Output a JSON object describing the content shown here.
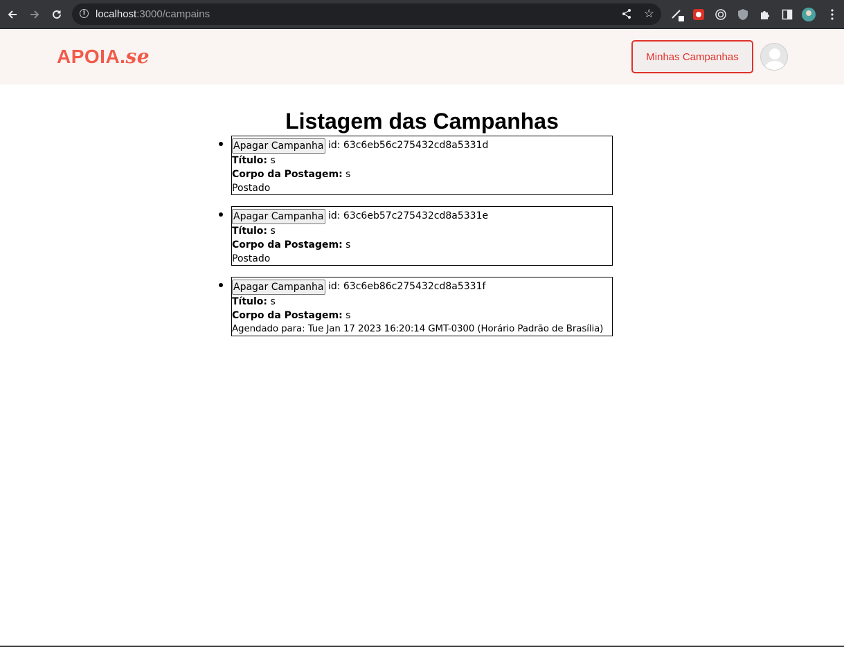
{
  "browser": {
    "url_host": "localhost",
    "url_path": ":3000/campains"
  },
  "header": {
    "logo_main": "APOIA.",
    "logo_suffix": "se",
    "my_campaigns_label": "Minhas Campanhas"
  },
  "main": {
    "title": "Listagem das Campanhas",
    "delete_label": "Apagar Campanha",
    "id_prefix": "id: ",
    "title_label": "Título:",
    "body_label": "Corpo da Postagem:",
    "campaigns": [
      {
        "id": "63c6eb56c275432cd8a5331d",
        "title": "s",
        "body": "s",
        "status": "Postado"
      },
      {
        "id": "63c6eb57c275432cd8a5331e",
        "title": "s",
        "body": "s",
        "status": "Postado"
      },
      {
        "id": "63c6eb86c275432cd8a5331f",
        "title": "s",
        "body": "s",
        "status": "Agendado para: Tue Jan 17 2023 16:20:14 GMT-0300 (Horário Padrão de Brasília)"
      }
    ]
  },
  "colors": {
    "brand": "#f15a4a",
    "button_border": "#e0322a",
    "header_bg": "#faf4f2"
  }
}
